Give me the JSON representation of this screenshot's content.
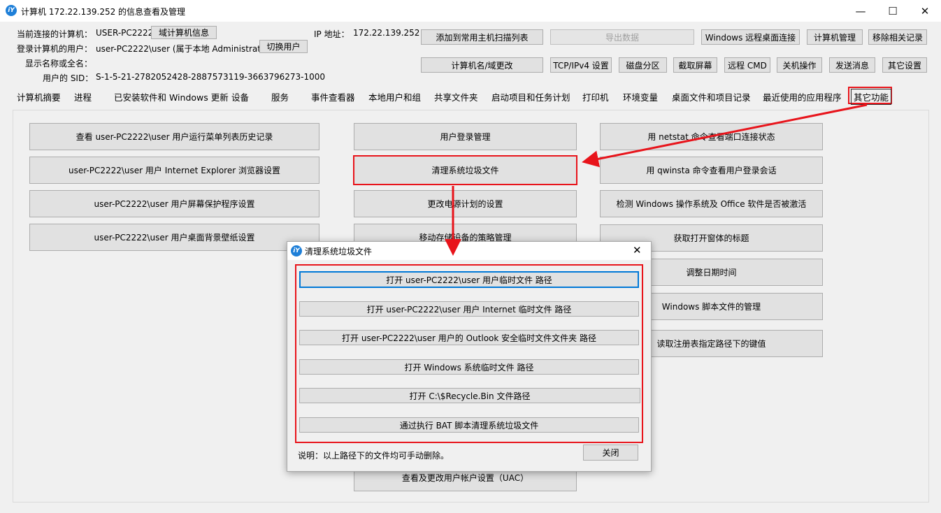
{
  "window": {
    "icon_text": "iY",
    "title": "计算机 172.22.139.252 的信息查看及管理",
    "minimize": "—",
    "maximize": "☐",
    "close": "✕"
  },
  "info": {
    "computer_label": "当前连接的计算机：",
    "computer_value": "USER-PC2222",
    "domain_btn": "域计算机信息",
    "ip_label": "IP 地址：",
    "ip_value": "172.22.139.252",
    "user_label": "登录计算机的用户：",
    "user_value": "user-PC2222\\user (属于本地 Administrators 组)",
    "switch_btn": "切换用户",
    "displayname_label": "显示名称或全名：",
    "sid_label": "用户的 SID：",
    "sid_value": "S-1-5-21-2782052428-2887573119-3663796273-1000"
  },
  "toolbar": {
    "row1": [
      "添加到常用主机扫描列表",
      "导出数据",
      "Windows 远程桌面连接",
      "计算机管理",
      "移除相关记录"
    ],
    "row2": [
      "计算机名/域更改",
      "TCP/IPv4 设置",
      "磁盘分区",
      "截取屏幕",
      "远程 CMD",
      "关机操作",
      "发送消息",
      "其它设置"
    ]
  },
  "tabs": [
    "计算机摘要",
    "进程",
    "已安装软件和 Windows 更新",
    "设备",
    "服务",
    "事件查看器",
    "本地用户和组",
    "共享文件夹",
    "启动项目和任务计划",
    "打印机",
    "环境变量",
    "桌面文件和项目记录",
    "最近使用的应用程序",
    "其它功能"
  ],
  "features": {
    "col1": [
      "查看 user-PC2222\\user 用户运行菜单列表历史记录",
      "user-PC2222\\user 用户 Internet Explorer 浏览器设置",
      "user-PC2222\\user 用户屏幕保护程序设置",
      "user-PC2222\\user 用户桌面背景壁纸设置"
    ],
    "col2": [
      "用户登录管理",
      "清理系统垃圾文件",
      "更改电源计划的设置",
      "移动存储设备的策略管理",
      "查看及更改用户帐户设置（UAC）"
    ],
    "col3": [
      "用 netstat 命令查看端口连接状态",
      "用 qwinsta 命令查看用户登录会话",
      "检测 Windows 操作系统及 Office 软件是否被激活",
      "获取打开窗体的标题",
      "调整日期时间",
      "Windows 脚本文件的管理",
      "读取注册表指定路径下的键值"
    ]
  },
  "dialog": {
    "title": "清理系统垃圾文件",
    "close_icon": "✕",
    "buttons": [
      "打开 user-PC2222\\user 用户临时文件 路径",
      "打开 user-PC2222\\user 用户 Internet 临时文件 路径",
      "打开 user-PC2222\\user 用户的 Outlook 安全临时文件文件夹 路径",
      "打开 Windows 系统临时文件 路径",
      "打开 C:\\$Recycle.Bin 文件路径",
      "通过执行 BAT 脚本清理系统垃圾文件"
    ],
    "note": "说明：以上路径下的文件均可手动删除。",
    "close_btn": "关闭"
  },
  "colors": {
    "highlight": "#e8141b",
    "focus": "#0078d7",
    "icon": "#1e7fd8"
  }
}
